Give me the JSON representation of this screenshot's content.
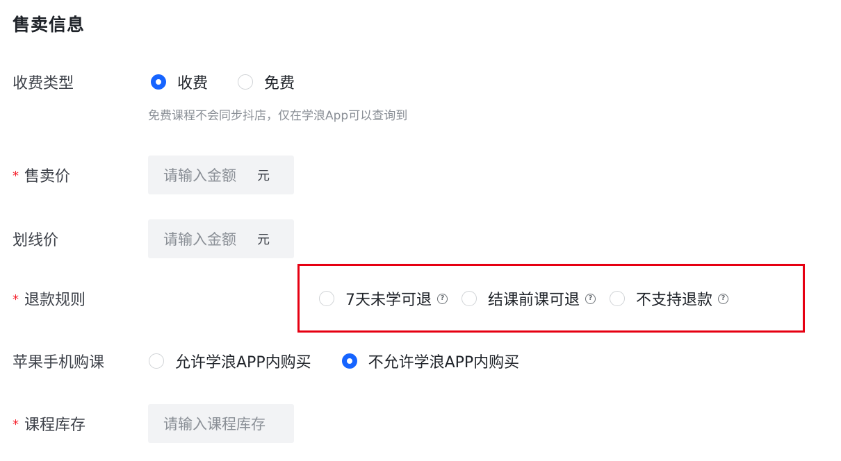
{
  "section_title": "售卖信息",
  "fee_type": {
    "label": "收费类型",
    "options": [
      "收费",
      "免费"
    ],
    "selected": "收费",
    "hint": "免费课程不会同步抖店，仅在学浪App可以查询到"
  },
  "sale_price": {
    "label": "售卖价",
    "required_mark": "*",
    "placeholder": "请输入金额",
    "unit": "元"
  },
  "list_price": {
    "label": "划线价",
    "placeholder": "请输入金额",
    "unit": "元"
  },
  "refund_rule": {
    "label": "退款规则",
    "required_mark": "*",
    "options": [
      "7天未学可退",
      "结课前课可退",
      "不支持退款"
    ],
    "selected": null,
    "help_icon_glyph": "?"
  },
  "apple_purchase": {
    "label": "苹果手机购课",
    "options": [
      "允许学浪APP内购买",
      "不允许学浪APP内购买"
    ],
    "selected": "不允许学浪APP内购买"
  },
  "course_stock": {
    "label": "课程库存",
    "required_mark": "*",
    "placeholder": "请输入课程库存"
  },
  "colors": {
    "primary": "#1664ff",
    "required": "#f5222d",
    "highlight_border": "#e60012",
    "input_bg": "#f2f3f5"
  }
}
